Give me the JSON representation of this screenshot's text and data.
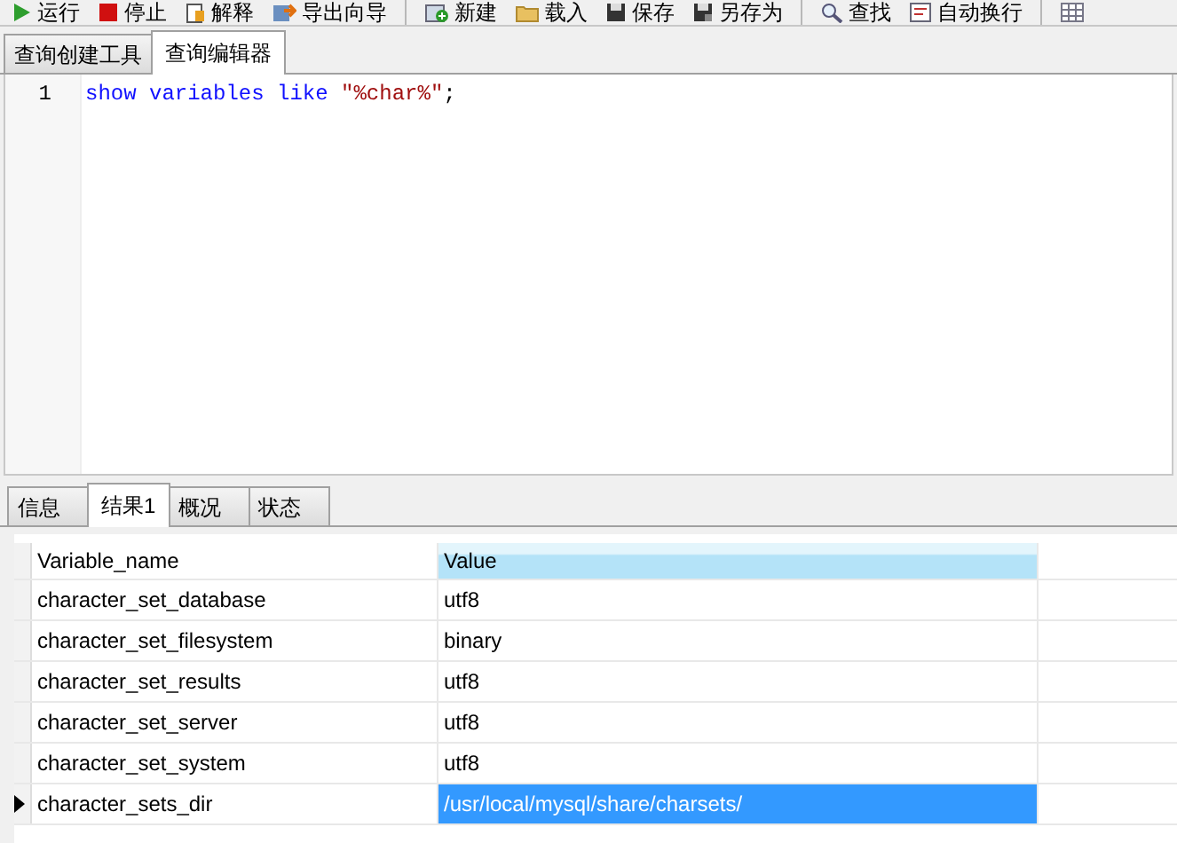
{
  "toolbar_groups": [
    {
      "buttons": [
        {
          "kind": "run",
          "label": "运行"
        },
        {
          "kind": "stop",
          "label": "停止"
        },
        {
          "kind": "explain",
          "label": "解释"
        },
        {
          "kind": "export",
          "label": "导出向导"
        }
      ]
    },
    {
      "buttons": [
        {
          "kind": "new",
          "label": "新建"
        },
        {
          "kind": "load",
          "label": "载入"
        },
        {
          "kind": "save",
          "label": "保存"
        },
        {
          "kind": "save_as",
          "label": "另存为"
        }
      ]
    },
    {
      "buttons": [
        {
          "kind": "find",
          "label": "查找"
        },
        {
          "kind": "wrap",
          "label": "自动换行"
        }
      ]
    },
    {
      "buttons": [
        {
          "kind": "grid"
        }
      ]
    }
  ],
  "editor_tabs": [
    {
      "label": "查询创建工具",
      "selected": false
    },
    {
      "label": "查询编辑器",
      "selected": true
    }
  ],
  "editor": {
    "lines": [
      {
        "number": "1",
        "tokens": [
          {
            "kind": "keyword",
            "text": "show variables like"
          },
          {
            "kind": "string",
            "text": "\"%char%\""
          },
          {
            "kind": "plain",
            "text": ";"
          }
        ]
      }
    ]
  },
  "result_tabs": [
    {
      "label": "信息",
      "selected": false
    },
    {
      "label": "结果1",
      "selected": true
    },
    {
      "label": "概况",
      "selected": false
    },
    {
      "label": "状态",
      "selected": false
    }
  ],
  "grid": {
    "columns": [
      {
        "label": "Variable_name",
        "selected": false
      },
      {
        "label": "Value",
        "selected": true
      }
    ],
    "rows": [
      {
        "cells": [
          "character_set_database",
          "utf8"
        ],
        "selected": false
      },
      {
        "cells": [
          "character_set_filesystem",
          "binary"
        ],
        "selected": false
      },
      {
        "cells": [
          "character_set_results",
          "utf8"
        ],
        "selected": false
      },
      {
        "cells": [
          "character_set_server",
          "utf8"
        ],
        "selected": false
      },
      {
        "cells": [
          "character_set_system",
          "utf8"
        ],
        "selected": false
      },
      {
        "cells": [
          "character_sets_dir",
          "/usr/local/mysql/share/charsets/"
        ],
        "selected": true
      }
    ]
  }
}
